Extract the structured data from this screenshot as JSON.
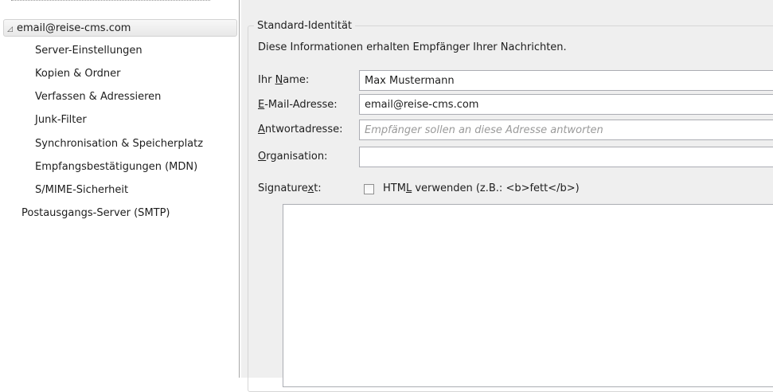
{
  "sidebar": {
    "account": {
      "label": "email@reise-cms.com",
      "expander": "◿"
    },
    "items": [
      {
        "label": "Server-Einstellungen"
      },
      {
        "label": "Kopien & Ordner"
      },
      {
        "label": "Verfassen & Adressieren"
      },
      {
        "label": "Junk-Filter"
      },
      {
        "label": "Synchronisation & Speicherplatz"
      },
      {
        "label": "Empfangsbestätigungen (MDN)"
      },
      {
        "label": "S/MIME-Sicherheit"
      }
    ],
    "smtp": {
      "label": "Postausgangs-Server (SMTP)"
    }
  },
  "identity": {
    "legend": "Standard-Identität",
    "description": "Diese Informationen erhalten Empfänger Ihrer Nachrichten.",
    "name": {
      "label_pre": "Ihr ",
      "label_key": "N",
      "label_post": "ame:",
      "value": "Max Mustermann"
    },
    "email": {
      "label_pre": "",
      "label_key": "E",
      "label_post": "-Mail-Adresse:",
      "value": "email@reise-cms.com"
    },
    "reply": {
      "label_pre": "",
      "label_key": "A",
      "label_post": "ntwortadresse:",
      "value": "",
      "placeholder": "Empfänger sollen an diese Adresse antworten"
    },
    "org": {
      "label_pre": "",
      "label_key": "O",
      "label_post": "rganisation:",
      "value": ""
    },
    "signature": {
      "label_pre": "Signature",
      "label_key": "x",
      "label_post": "t:",
      "html_pre": "HTM",
      "html_key": "L",
      "html_post": " verwenden (z.B.: <b>fett</b>)",
      "html_checked": false,
      "text": ""
    }
  },
  "colors": {
    "panel_bg": "#efefef",
    "selection_bg": "#e8e8e8",
    "border": "#abadb3"
  }
}
